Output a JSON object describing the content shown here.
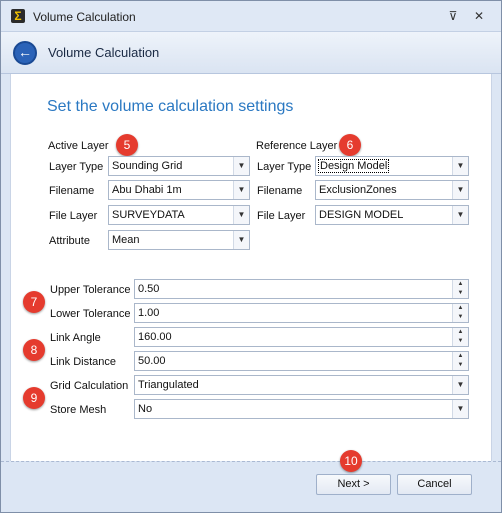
{
  "window": {
    "title": "Volume Calculation",
    "app_icon": "Σ"
  },
  "header": {
    "title": "Volume Calculation"
  },
  "content": {
    "heading": "Set the volume calculation settings",
    "active": {
      "section_label": "Active Layer",
      "layer_type_label": "Layer Type",
      "layer_type_value": "Sounding Grid",
      "filename_label": "Filename",
      "filename_value": "Abu Dhabi 1m",
      "file_layer_label": "File Layer",
      "file_layer_value": "SURVEYDATA",
      "attribute_label": "Attribute",
      "attribute_value": "Mean"
    },
    "reference": {
      "section_label": "Reference Layer",
      "layer_type_label": "Layer Type",
      "layer_type_value": "Design Model",
      "filename_label": "Filename",
      "filename_value": "ExclusionZones",
      "file_layer_label": "File Layer",
      "file_layer_value": "DESIGN MODEL"
    },
    "settings": {
      "upper_tolerance_label": "Upper Tolerance",
      "upper_tolerance_value": "0.50",
      "lower_tolerance_label": "Lower Tolerance",
      "lower_tolerance_value": "1.00",
      "link_angle_label": "Link Angle",
      "link_angle_value": "160.00",
      "link_distance_label": "Link Distance",
      "link_distance_value": "50.00",
      "grid_calculation_label": "Grid Calculation",
      "grid_calculation_value": "Triangulated",
      "store_mesh_label": "Store Mesh",
      "store_mesh_value": "No"
    }
  },
  "badges": [
    "5",
    "6",
    "7",
    "8",
    "9",
    "10"
  ],
  "footer": {
    "next_label": "Next >",
    "cancel_label": "Cancel"
  },
  "colors": {
    "heading": "#2a78c2",
    "badge": "#e53b2e",
    "accent": "#2b63b8"
  }
}
